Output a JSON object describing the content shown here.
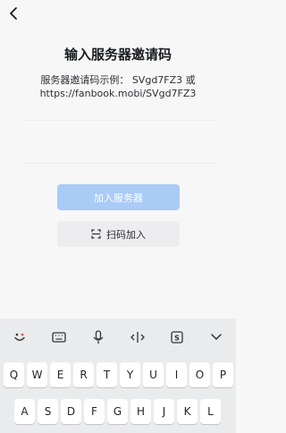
{
  "header": {
    "back_icon": "chevron-left-icon",
    "title": "输入服务器邀请码"
  },
  "hint": {
    "line1": "服务器邀请码示例： SVgd7FZ3 或",
    "line2": "https://fanbook.mobi/SVgd7FZ3"
  },
  "invite_input": {
    "value": "",
    "placeholder": ""
  },
  "buttons": {
    "join_label": "加入服务器",
    "scan_label": "扫码加入",
    "scan_icon": "scan-icon"
  },
  "keyboard": {
    "toolbar_icons": [
      "emoji-icon",
      "keyboard-icon",
      "microphone-icon",
      "cursor-move-icon",
      "clipboard-s-icon",
      "chevron-down-icon"
    ],
    "row1": [
      "Q",
      "W",
      "E",
      "R",
      "T",
      "Y",
      "U",
      "I",
      "O",
      "P"
    ],
    "row2": [
      "A",
      "S",
      "D",
      "F",
      "G",
      "H",
      "J",
      "K",
      "L"
    ]
  },
  "colors": {
    "background": "#f7f7f8",
    "join_button_disabled": "#a9cbf6",
    "scan_button": "#ededf0",
    "keyboard_background": "#eaebed"
  }
}
